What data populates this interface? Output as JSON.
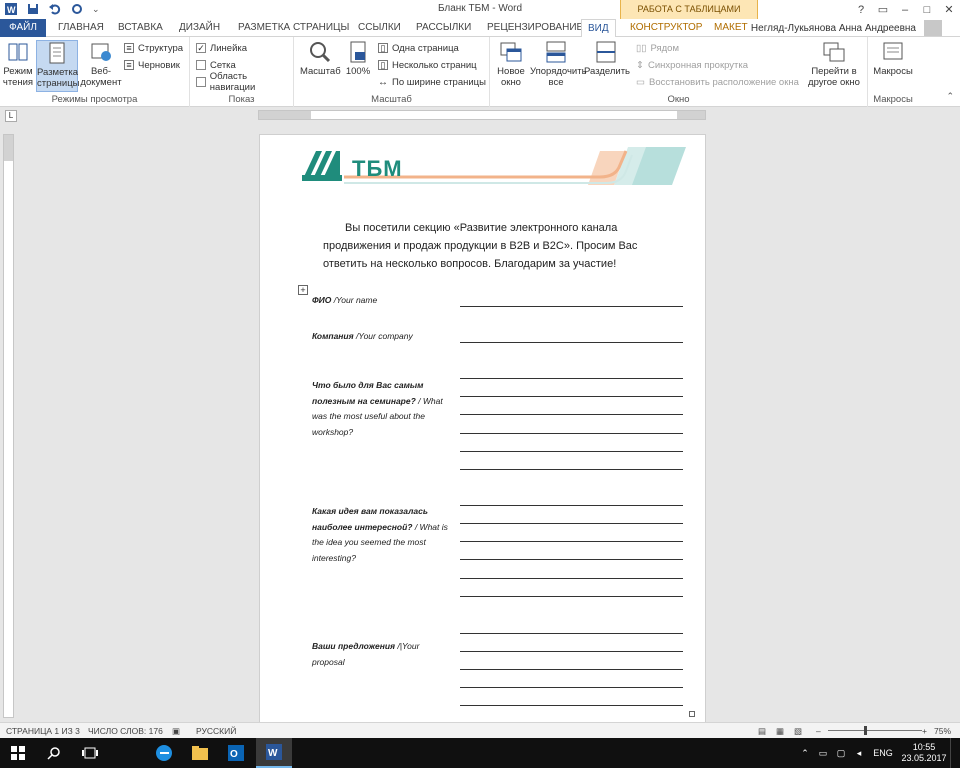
{
  "window": {
    "title": "Бланк ТБМ - Word",
    "context_group": "РАБОТА С ТАБЛИЦАМИ",
    "user": "Негляд-Лукьянова Анна Андреевна",
    "controls": [
      "?",
      "▭",
      "–",
      "□",
      "✕"
    ]
  },
  "tabs": [
    "ФАЙЛ",
    "ГЛАВНАЯ",
    "ВСТАВКА",
    "ДИЗАЙН",
    "РАЗМЕТКА СТРАНИЦЫ",
    "ССЫЛКИ",
    "РАССЫЛКИ",
    "РЕЦЕНЗИРОВАНИЕ",
    "ВИД",
    "КОНСТРУКТОР",
    "МАКЕТ"
  ],
  "ribbon": {
    "views": {
      "label": "Режимы просмотра",
      "read": "Режим\nчтения",
      "layout": "Разметка\nстраницы",
      "web": "Веб-\nдокумент",
      "outline": "Структура",
      "draft": "Черновик"
    },
    "show": {
      "label": "Показ",
      "ruler": "Линейка",
      "grid": "Сетка",
      "nav": "Область навигации"
    },
    "zoom": {
      "label": "Масштаб",
      "zoom": "Масштаб",
      "hundred": "100%",
      "one_page": "Одна страница",
      "multi_page": "Несколько страниц",
      "page_width": "По ширине страницы"
    },
    "window": {
      "label": "Окно",
      "new_window": "Новое\nокно",
      "arrange_all": "Упорядочить\nвсе",
      "split": "Разделить",
      "side_by_side": "Рядом",
      "sync_scroll": "Синхронная прокрутка",
      "reset_pos": "Восстановить расположение окна",
      "switch": "Перейти в\nдругое окно"
    },
    "macros": {
      "label": "Макросы",
      "macros": "Макросы"
    }
  },
  "document": {
    "logo_text": "ТБМ",
    "intro": "Вы посетили секцию «Развитие электронного канала продвижения и продаж продукции в B2B и B2C». Просим Вас ответить на несколько вопросов. Благодарим за участие!",
    "fields": [
      {
        "ru": "ФИО",
        "en": " /Your name"
      },
      {
        "ru": "Компания",
        "en": " /Your company"
      },
      {
        "ru": "Что было для Вас самым полезным на семинаре?",
        "en": " / What was the most useful about the workshop?"
      },
      {
        "ru": "Какая идея вам показалась наиболее интересной?",
        "en": " / What is the idea you seemed the most interesting?"
      },
      {
        "ru": "Ваши предложения",
        "en": " /|Your proposal"
      }
    ]
  },
  "status": {
    "page": "СТРАНИЦА 1 ИЗ 3",
    "words": "ЧИСЛО СЛОВ: 176",
    "lang": "РУССКИЙ",
    "zoom": "75%"
  },
  "taskbar": {
    "lang": "ENG",
    "time": "10:55",
    "date": "23.05.2017"
  },
  "colors": {
    "brand_green": "#1f8c7c",
    "word_blue": "#2b579a",
    "logo_orange": "#f2b38a",
    "logo_teal": "#b7dfdc"
  }
}
